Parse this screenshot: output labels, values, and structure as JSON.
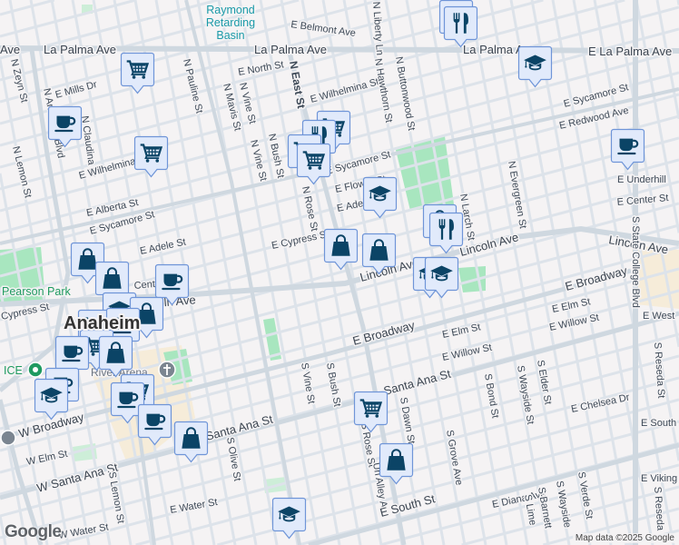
{
  "map": {
    "attribution": "Map data ©2025 Google",
    "logo": "Google",
    "places": {
      "basin_line1": "Raymond",
      "basin_line2": "Retarding",
      "basin_line3": "Basin",
      "park": "Pearson Park",
      "ice": "ICE",
      "arena": "River Arena",
      "city": "Anaheim"
    },
    "streets": {
      "la_palma_1": "Ave",
      "la_palma_2": "La Palma Ave",
      "la_palma_3": "La Palma Ave",
      "la_palma_4": "La Palma Ave",
      "la_palma_5": "E La Palma Ave",
      "belmont": "E Belmont Ave",
      "zeyn": "N Zeyn St",
      "mills": "E Mills Dr",
      "anaheim_blvd": "N Anaheim Blvd",
      "claudina": "N Claudina St",
      "lemon_n": "N Lemon St",
      "wilhelmina_1": "E Wilhelmina St",
      "wilhelmina_2": "E Wilhelmina St",
      "pauline": "N Pauline St",
      "mavis": "N Mavis St",
      "vine_n1": "N Vine St",
      "vine_n2": "N Vine St",
      "bush_n": "N Bush St",
      "north": "E North St",
      "east": "N East St",
      "liberty": "N Liberty Ln",
      "hawthorn": "N Hawthorn St",
      "buttonwood": "N Buttonwood St",
      "sycamore_1": "E Sycamore St",
      "sycamore_2": "E Sycamore St",
      "sycamore_3": "E Sycamore St",
      "redwood": "E Redwood Ave",
      "alberta": "E Alberta St",
      "adele_1": "E Adele St",
      "adele_2": "E Adele St",
      "flower": "E Flower St",
      "cypress_1": "E Cypress St",
      "cypress_2": "Cypress St",
      "rose_n": "N Rose St",
      "larch": "N Larch St",
      "evergreen": "N Evergreen St",
      "underhill": "E Underhill",
      "center_e": "E Center St",
      "center_w": "Center St",
      "lincoln_1": "Lincoln Ave",
      "lincoln_2": "Lincoln Ave",
      "lincoln_3": "Lincoln Ave",
      "lincoln_4": "Lincoln Ave",
      "state_college": "S State College Blvd",
      "broadway_1": "E Broadway",
      "broadway_2": "E Broadway",
      "broadway_3": "W Broadway",
      "elm_1": "E Elm St",
      "elm_2": "E Elm St",
      "elm_3": "W Elm St",
      "willow_1": "E Willow St",
      "willow_2": "E Willow St",
      "west": "E West",
      "reseda_1": "S Reseda St",
      "reseda_2": "S Reseda",
      "vine_s": "S Vine St",
      "bush_s": "S Bush St",
      "santa_ana_1": "Santa Ana St",
      "santa_ana_2": "Santa Ana St",
      "santa_ana_3": "W Santa Ana St",
      "dawn": "S Dawn St",
      "rose_s": "S Rose St",
      "alley": "Un Alley A",
      "grove": "S Grove Ave",
      "bond": "S Bond St",
      "wayside_1": "S Wayside St",
      "elder": "S Elder St",
      "chelsea": "E Chelsea Dr",
      "south_1": "E South",
      "south_2": "E South St",
      "viking": "E Viking",
      "diana": "E Diana Ave",
      "barnett": "S Barnett",
      "wayside_2": "S Wayside",
      "verde": "S Verde St",
      "lime": "S Lime",
      "olive": "S Olive St",
      "lemon_s": "S Lemon St",
      "water_1": "E Water St",
      "water_2": "W Water St"
    },
    "markers": [
      {
        "type": "grocery"
      },
      {
        "type": "cafe"
      },
      {
        "type": "grocery"
      },
      {
        "type": "grocery"
      },
      {
        "type": "restaurant"
      },
      {
        "type": "grocery"
      },
      {
        "type": "grocery"
      },
      {
        "type": "school"
      },
      {
        "type": "grocery"
      },
      {
        "type": "restaurant"
      },
      {
        "type": "school"
      },
      {
        "type": "cafe"
      },
      {
        "type": "shopping"
      },
      {
        "type": "restaurant"
      },
      {
        "type": "shopping"
      },
      {
        "type": "shopping"
      },
      {
        "type": "school"
      },
      {
        "type": "school"
      },
      {
        "type": "shopping"
      },
      {
        "type": "shopping"
      },
      {
        "type": "cafe"
      },
      {
        "type": "school"
      },
      {
        "type": "shopping"
      },
      {
        "type": "grocery"
      },
      {
        "type": "cafe"
      },
      {
        "type": "grocery"
      },
      {
        "type": "cafe"
      },
      {
        "type": "shopping"
      },
      {
        "type": "cafe"
      },
      {
        "type": "school"
      },
      {
        "type": "grocery"
      },
      {
        "type": "cafe"
      },
      {
        "type": "cafe"
      },
      {
        "type": "shopping"
      },
      {
        "type": "grocery"
      },
      {
        "type": "shopping"
      },
      {
        "type": "school"
      }
    ],
    "colors": {
      "background": "#f5f3f4",
      "road": "#d5dde5",
      "major_road": "#c9d3dc",
      "park": "#a8e6bf",
      "marker_fill": "#e1eafb",
      "marker_border": "#6f95d8",
      "marker_icon": "#0b4466"
    }
  }
}
